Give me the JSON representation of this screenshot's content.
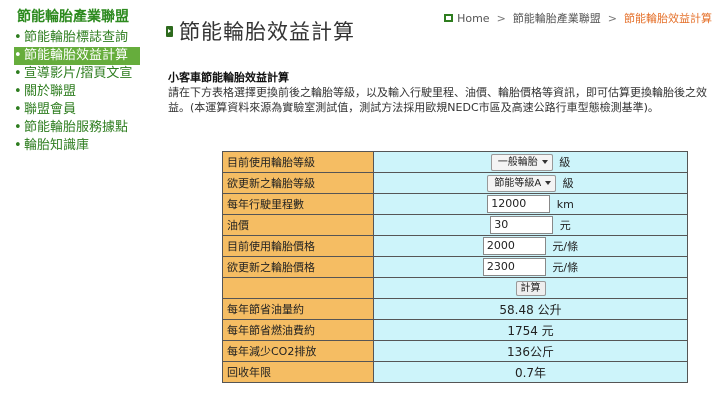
{
  "sidebar": {
    "brand": "節能輪胎產業聯盟",
    "items": [
      {
        "label": "節能輪胎標誌查詢",
        "active": false
      },
      {
        "label": "節能輪胎效益計算",
        "active": true
      },
      {
        "label": "宣導影片/摺頁文宣",
        "active": false
      },
      {
        "label": "關於聯盟",
        "active": false
      },
      {
        "label": "聯盟會員",
        "active": false
      },
      {
        "label": "節能輪胎服務據點",
        "active": false
      },
      {
        "label": "輪胎知識庫",
        "active": false
      }
    ]
  },
  "header": {
    "title": "節能輪胎效益計算",
    "breadcrumb": [
      "Home",
      "節能輪胎產業聯盟",
      "節能輪胎效益計算"
    ]
  },
  "intro": {
    "title": "小客車節能輪胎效益計算",
    "text": "請在下方表格選擇更換前後之輪胎等級，以及輸入行駛里程、油價、輪胎價格等資訊，即可估算更換輪胎後之效益。(本運算資料來源為實驗室測試值，測試方法採用歐規NEDC市區及高速公路行車型態檢測基準)。"
  },
  "form": {
    "current_grade": {
      "label": "目前使用輪胎等級",
      "value": "一般輪胎",
      "unit": "級"
    },
    "new_grade": {
      "label": "欲更新之輪胎等級",
      "value": "節能等級A",
      "unit": "級"
    },
    "mileage": {
      "label": "每年行駛里程數",
      "value": "12000",
      "unit": "km"
    },
    "fuel_price": {
      "label": "油價",
      "value": "30",
      "unit": "元"
    },
    "current_price": {
      "label": "目前使用輪胎價格",
      "value": "2000",
      "unit": "元/條"
    },
    "new_price": {
      "label": "欲更新之輪胎價格",
      "value": "2300",
      "unit": "元/條"
    },
    "calc_button": "計算"
  },
  "results": {
    "fuel_saved": {
      "label": "每年節省油量約",
      "value": "58.48 公升"
    },
    "cost_saved": {
      "label": "每年節省燃油費約",
      "value": "1754 元"
    },
    "co2_reduced": {
      "label": "每年減少CO2排放",
      "value": "136公斤"
    },
    "payback": {
      "label": "回收年限",
      "value": "0.7年"
    }
  },
  "colors": {
    "brand_green": "#2d8a1f",
    "active_menu_bg": "#66ad3c",
    "label_cell": "#f5bd63",
    "value_cell": "#cdf4fa",
    "breadcrumb_current": "#e5702a"
  }
}
